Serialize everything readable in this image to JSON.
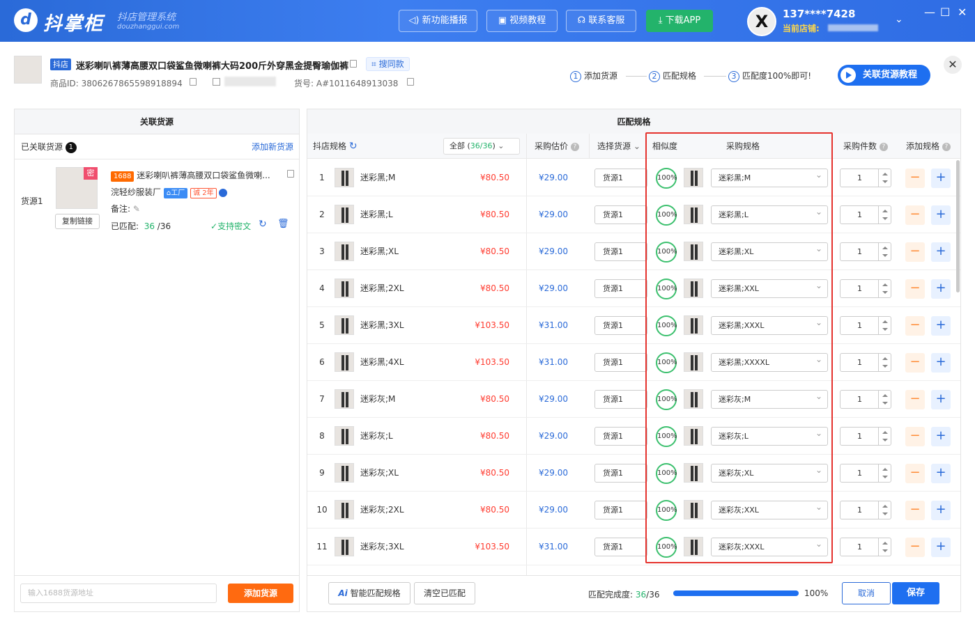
{
  "topbar": {
    "logo_mark": "d",
    "logo_text": "抖掌柜",
    "logo_sub": "抖店管理系统",
    "logo_url": "douzhanggui.com",
    "buttons": [
      "新功能播报",
      "视频教程",
      "联系客服",
      "下载APP"
    ],
    "avatar_letter": "X",
    "phone": "137****7428",
    "store_label": "当前店铺:",
    "window_controls": [
      "—",
      "☐",
      "✕"
    ]
  },
  "product": {
    "platform_tag": "抖店",
    "title": "迷彩喇叭裤薄高腰双口袋鲨鱼微喇裤大码200斤外穿黑金提臀瑜伽裤",
    "same_style_button": "搜同款",
    "id_label": "商品ID: 3806267865598918894",
    "sku_label": "货号:  A#1011648913038"
  },
  "steps": [
    "添加货源",
    "匹配规格",
    "匹配度100%即可!"
  ],
  "tutorial_button": "关联货源教程",
  "left_panel": {
    "title": "关联货源",
    "linked_label": "已关联货源",
    "linked_count": "1",
    "add_new_link": "添加新货源",
    "source_name": "货源1",
    "source_badge": "密",
    "copy_link_button": "复制链接",
    "tag_1688": "1688",
    "source_title": "迷彩喇叭裤薄高腰双口袋鲨鱼微喇...",
    "factory_name": "浣轻纱服装厂",
    "factory_tag": "工厂",
    "cheng_tag": "诚",
    "year_tag": "2年",
    "note_label": "备注:",
    "matched_label": "已匹配:",
    "matched_value": "36",
    "matched_total": "/36",
    "support_text": "支持密文",
    "input_placeholder": "输入1688货源地址",
    "add_source_button": "添加货源"
  },
  "right_panel": {
    "title": "匹配规格",
    "columns": {
      "shop_spec": "抖店规格",
      "filter": "全部",
      "filter_count": "36/36",
      "cost_estimate": "采购估价",
      "select_source": "选择货源",
      "similarity": "相似度",
      "purchase_spec": "采购规格",
      "purchase_qty": "采购件数",
      "add_spec": "添加规格"
    },
    "rows": [
      {
        "n": "1",
        "spec": "迷彩黑;M",
        "price": "¥80.50",
        "cost": "¥29.00",
        "src": "货源1",
        "sim": "100%",
        "pspec": "迷彩黑;M",
        "qty": "1"
      },
      {
        "n": "2",
        "spec": "迷彩黑;L",
        "price": "¥80.50",
        "cost": "¥29.00",
        "src": "货源1",
        "sim": "100%",
        "pspec": "迷彩黑;L",
        "qty": "1"
      },
      {
        "n": "3",
        "spec": "迷彩黑;XL",
        "price": "¥80.50",
        "cost": "¥29.00",
        "src": "货源1",
        "sim": "100%",
        "pspec": "迷彩黑;XL",
        "qty": "1"
      },
      {
        "n": "4",
        "spec": "迷彩黑;2XL",
        "price": "¥80.50",
        "cost": "¥29.00",
        "src": "货源1",
        "sim": "100%",
        "pspec": "迷彩黑;XXL",
        "qty": "1"
      },
      {
        "n": "5",
        "spec": "迷彩黑;3XL",
        "price": "¥103.50",
        "cost": "¥31.00",
        "src": "货源1",
        "sim": "100%",
        "pspec": "迷彩黑;XXXL",
        "qty": "1"
      },
      {
        "n": "6",
        "spec": "迷彩黑;4XL",
        "price": "¥103.50",
        "cost": "¥31.00",
        "src": "货源1",
        "sim": "100%",
        "pspec": "迷彩黑;XXXXL",
        "qty": "1"
      },
      {
        "n": "7",
        "spec": "迷彩灰;M",
        "price": "¥80.50",
        "cost": "¥29.00",
        "src": "货源1",
        "sim": "100%",
        "pspec": "迷彩灰;M",
        "qty": "1"
      },
      {
        "n": "8",
        "spec": "迷彩灰;L",
        "price": "¥80.50",
        "cost": "¥29.00",
        "src": "货源1",
        "sim": "100%",
        "pspec": "迷彩灰;L",
        "qty": "1"
      },
      {
        "n": "9",
        "spec": "迷彩灰;XL",
        "price": "¥80.50",
        "cost": "¥29.00",
        "src": "货源1",
        "sim": "100%",
        "pspec": "迷彩灰;XL",
        "qty": "1"
      },
      {
        "n": "10",
        "spec": "迷彩灰;2XL",
        "price": "¥80.50",
        "cost": "¥29.00",
        "src": "货源1",
        "sim": "100%",
        "pspec": "迷彩灰;XXL",
        "qty": "1"
      },
      {
        "n": "11",
        "spec": "迷彩灰;3XL",
        "price": "¥103.50",
        "cost": "¥31.00",
        "src": "货源1",
        "sim": "100%",
        "pspec": "迷彩灰;XXXL",
        "qty": "1"
      }
    ],
    "footer": {
      "smart_match": "智能匹配规格",
      "smart_icon": "Ai",
      "clear_matched": "清空已匹配",
      "completion_label": "匹配完成度:",
      "completion_value": "36",
      "completion_total": "/36",
      "completion_percent": "100%",
      "progress": 1.0,
      "cancel": "取消",
      "save": "保存"
    }
  },
  "colors": {
    "primary": "#1e6ff0",
    "price": "#ff3b2f",
    "highlight_box": "#e5322d",
    "match_ring": "#3cc06e"
  }
}
